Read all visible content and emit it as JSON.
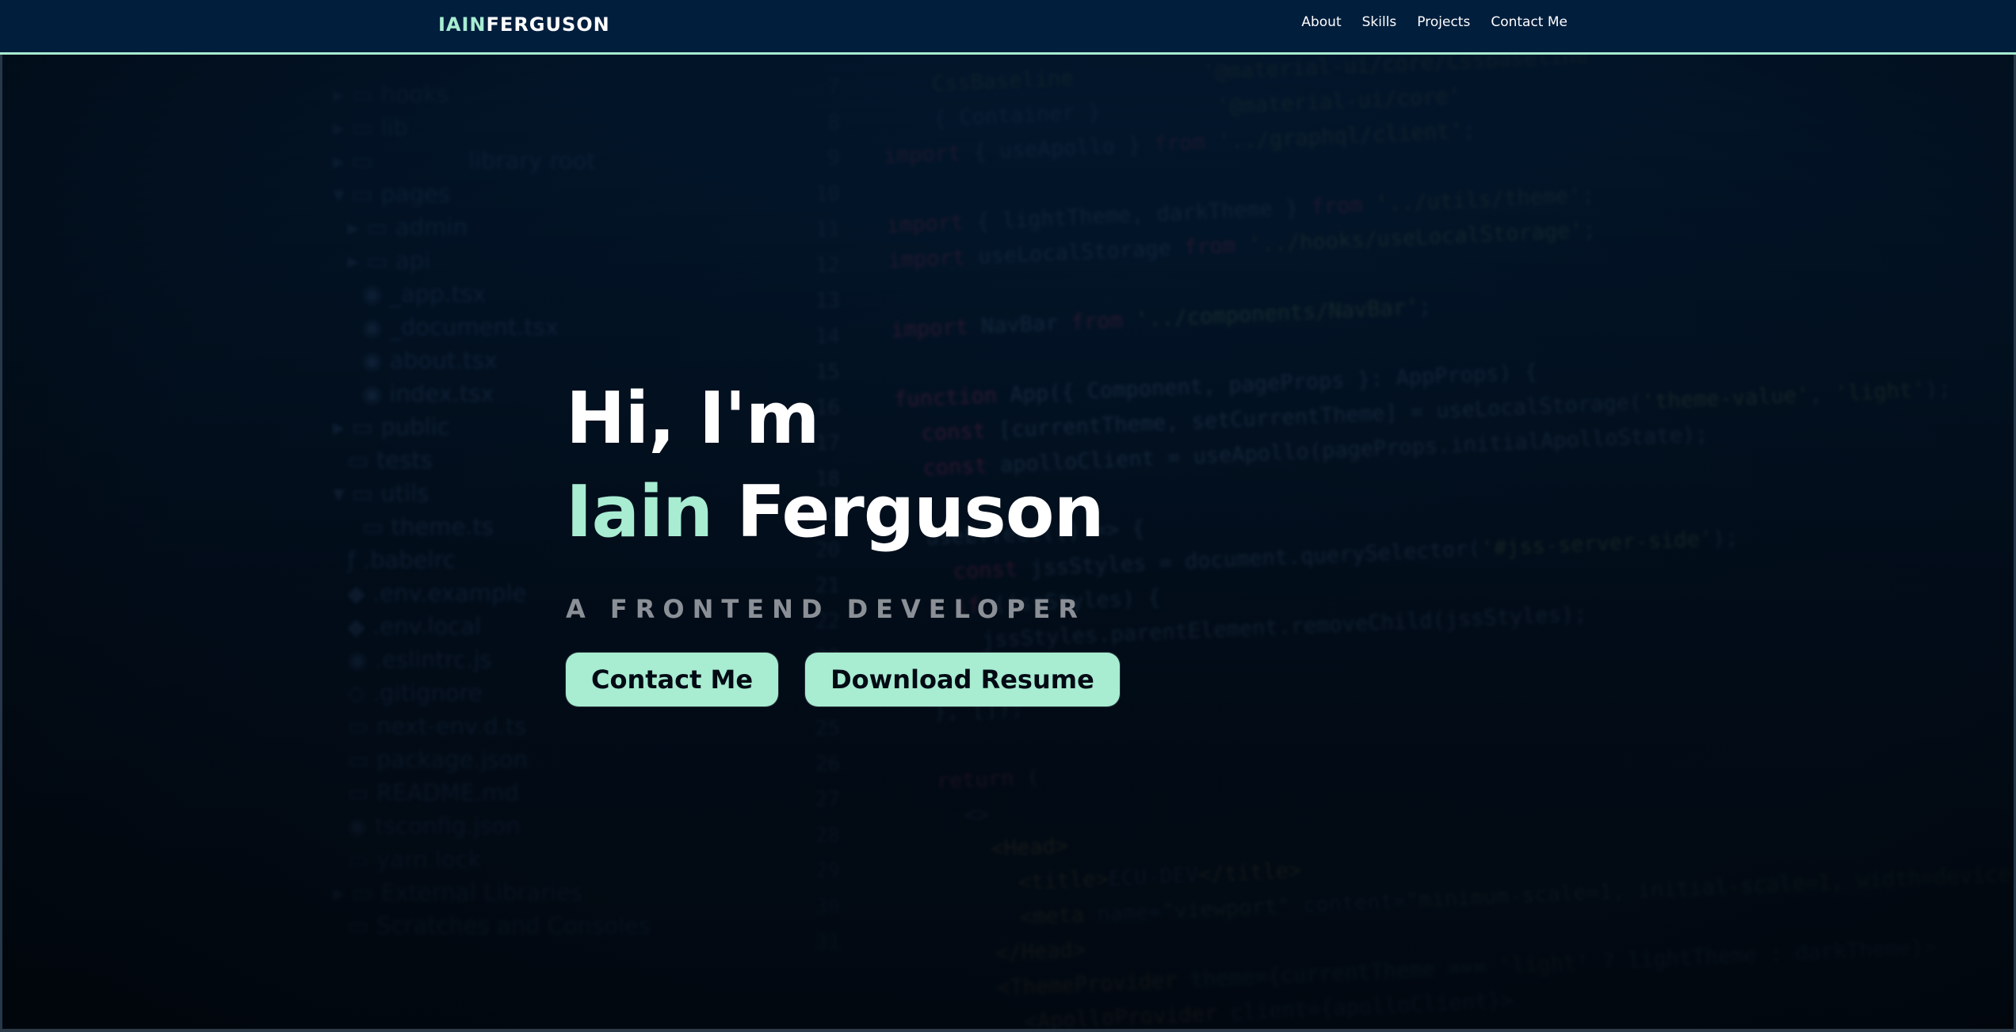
{
  "logo": {
    "accent": "IAIN",
    "rest": "FERGUSON"
  },
  "nav": {
    "links": [
      "About",
      "Skills",
      "Projects",
      "Contact Me"
    ]
  },
  "hero": {
    "greeting": "Hi, I'm",
    "first_name": "Iain",
    "last_name": "Ferguson",
    "subtitle": "A FRONTEND DEVELOPER",
    "buttons": {
      "contact": "Contact Me",
      "resume": "Download Resume"
    }
  },
  "colors": {
    "accent": "#a8ecd2",
    "nav_bg": "#021e3d",
    "page_bg": "#020a14",
    "subtitle": "#8b8f96"
  }
}
